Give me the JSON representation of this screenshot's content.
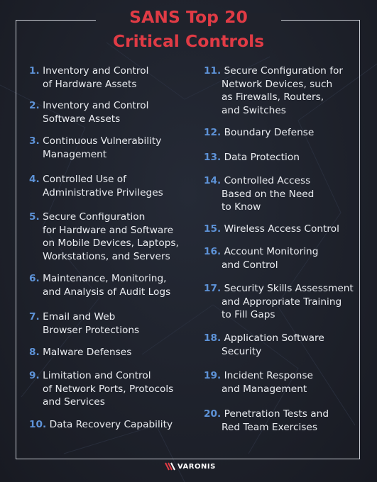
{
  "title": {
    "line1": "SANS Top 20",
    "line2": "Critical Controls"
  },
  "items": [
    {
      "num": "1.",
      "lines": [
        "Inventory and Control",
        "of Hardware Assets"
      ]
    },
    {
      "num": "2.",
      "lines": [
        "Inventory and Control",
        "Software Assets"
      ]
    },
    {
      "num": "3.",
      "lines": [
        "Continuous Vulnerability",
        "Management"
      ]
    },
    {
      "num": "4.",
      "lines": [
        "Controlled Use of",
        "Administrative Privileges"
      ]
    },
    {
      "num": "5.",
      "lines": [
        "Secure Configuration",
        "for Hardware and Software",
        "on Mobile Devices, Laptops,",
        "Workstations, and Servers"
      ]
    },
    {
      "num": "6.",
      "lines": [
        "Maintenance, Monitoring,",
        "and Analysis of Audit Logs"
      ]
    },
    {
      "num": "7.",
      "lines": [
        "Email and Web",
        "Browser Protections"
      ]
    },
    {
      "num": "8.",
      "lines": [
        "Malware Defenses"
      ]
    },
    {
      "num": "9.",
      "lines": [
        "Limitation and Control",
        "of Network Ports, Protocols",
        "and Services"
      ]
    },
    {
      "num": "10.",
      "lines": [
        "Data Recovery Capability"
      ]
    },
    {
      "num": "11.",
      "lines": [
        "Secure Configuration for",
        "Network Devices, such",
        "as Firewalls, Routers,",
        "and Switches"
      ]
    },
    {
      "num": "12.",
      "lines": [
        "Boundary Defense"
      ]
    },
    {
      "num": "13.",
      "lines": [
        "Data Protection"
      ]
    },
    {
      "num": "14.",
      "lines": [
        "Controlled Access",
        "Based on the Need",
        "to Know"
      ]
    },
    {
      "num": "15.",
      "lines": [
        "Wireless Access Control"
      ]
    },
    {
      "num": "16.",
      "lines": [
        "Account Monitoring",
        "and Control"
      ]
    },
    {
      "num": "17.",
      "lines": [
        "Security Skills Assessment",
        "and Appropriate Training",
        "to Fill Gaps"
      ]
    },
    {
      "num": "18.",
      "lines": [
        "Application Software",
        "Security"
      ]
    },
    {
      "num": "19.",
      "lines": [
        "Incident Response",
        "and Management"
      ]
    },
    {
      "num": "20.",
      "lines": [
        "Penetration Tests and",
        "Red Team Exercises"
      ]
    }
  ],
  "logo": {
    "text": "VARONIS"
  },
  "colors": {
    "title": "#e03b45",
    "number": "#5e93d8",
    "text": "#eaecf0",
    "background": "#1d2029"
  }
}
